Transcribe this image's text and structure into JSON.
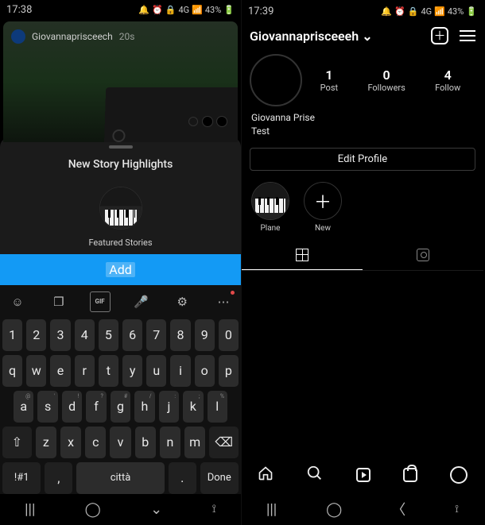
{
  "left": {
    "status": {
      "time": "17:38",
      "battery": "43%",
      "signal": "4G"
    },
    "story": {
      "user": "Giovannaprisceech",
      "age": "20s"
    },
    "sheet": {
      "title": "New Story Highlights",
      "subtitle": "Featured Stories"
    },
    "add_label": "Add",
    "keyboard": {
      "numbers": [
        "1",
        "2",
        "3",
        "4",
        "5",
        "6",
        "7",
        "8",
        "9",
        "0"
      ],
      "row1": [
        "q",
        "w",
        "e",
        "r",
        "t",
        "y",
        "u",
        "i",
        "o",
        "p"
      ],
      "row2": [
        "a",
        "s",
        "d",
        "f",
        "g",
        "h",
        "j",
        "k",
        "l"
      ],
      "row3_shift": "⇧",
      "row3": [
        "z",
        "x",
        "c",
        "v",
        "b",
        "n",
        "m"
      ],
      "row3_bksp": "⌫",
      "row2_sup": [
        "@",
        "'",
        "!",
        "?",
        "#",
        "/",
        ":",
        ";",
        "%"
      ],
      "bottom": {
        "sym": "!#1",
        "comma": ",",
        "space": "città",
        "dot": ".",
        "done": "Done"
      }
    }
  },
  "right": {
    "status": {
      "time": "17:39",
      "battery": "43%",
      "signal": "4G"
    },
    "username": "Giovannaprisceeeh",
    "stats": {
      "posts_n": "1",
      "posts_l": "Post",
      "followers_n": "0",
      "followers_l": "Followers",
      "following_n": "4",
      "following_l": "Follow"
    },
    "bio": {
      "name": "Giovanna Prise",
      "line2": "Test"
    },
    "edit_label": "Edit Profile",
    "highlights": [
      {
        "label": "Plane",
        "kind": "piano"
      },
      {
        "label": "New",
        "kind": "add"
      }
    ]
  }
}
